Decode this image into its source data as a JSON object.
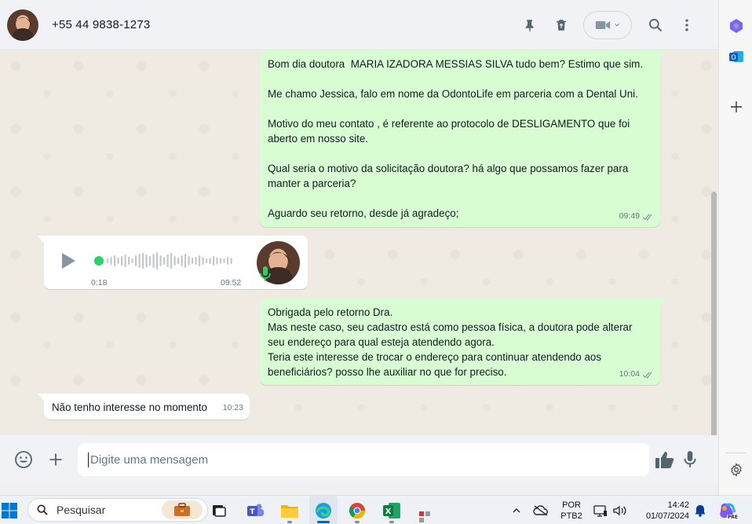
{
  "header": {
    "contact": "+55 44 9838-1273"
  },
  "messages": [
    {
      "type": "out",
      "paragraphs": [
        "Bom dia doutora  MARIA IZADORA MESSIAS SILVA tudo bem? Estimo que sim.",
        "Me chamo Jessica, falo em nome da OdontoLife em parceria com a Dental Uni.",
        "Motivo do meu contato , é referente ao protocolo de DESLIGAMENTO que foi\naberto em nosso site.",
        "Qual seria o motivo da solicitação doutora? há algo que possamos fazer para\nmanter a parceria?",
        "Aguardo seu retorno, desde já agradeço;"
      ],
      "time": "09:49"
    },
    {
      "type": "voice",
      "duration": "0:18",
      "time": "09:52",
      "progress": 0
    },
    {
      "type": "out",
      "text": "Obrigada pelo retorno Dra.\nMas neste caso, seu cadastro está como pessoa física, a doutora pode alterar\nseu endereço para qual esteja atendendo agora.\nTeria este interesse de trocar o endereço para continuar atendendo aos\nbeneficiários? posso lhe auxiliar no que for preciso.",
      "time": "10:04"
    },
    {
      "type": "in",
      "text": "Não tenho interesse no momento",
      "time": "10:23"
    }
  ],
  "composer": {
    "placeholder": "Digite uma mensagem"
  },
  "taskbar": {
    "search_placeholder": "Pesquisar",
    "language": "POR",
    "keyboard": "PTB2",
    "time": "14:42",
    "date": "01/07/2024",
    "copilot_badge": "PRE"
  },
  "colors": {
    "outgoing_bubble": "#d9fdd3",
    "incoming_bubble": "#ffffff",
    "accent_green": "#25d366",
    "chat_background": "#efeae2"
  }
}
